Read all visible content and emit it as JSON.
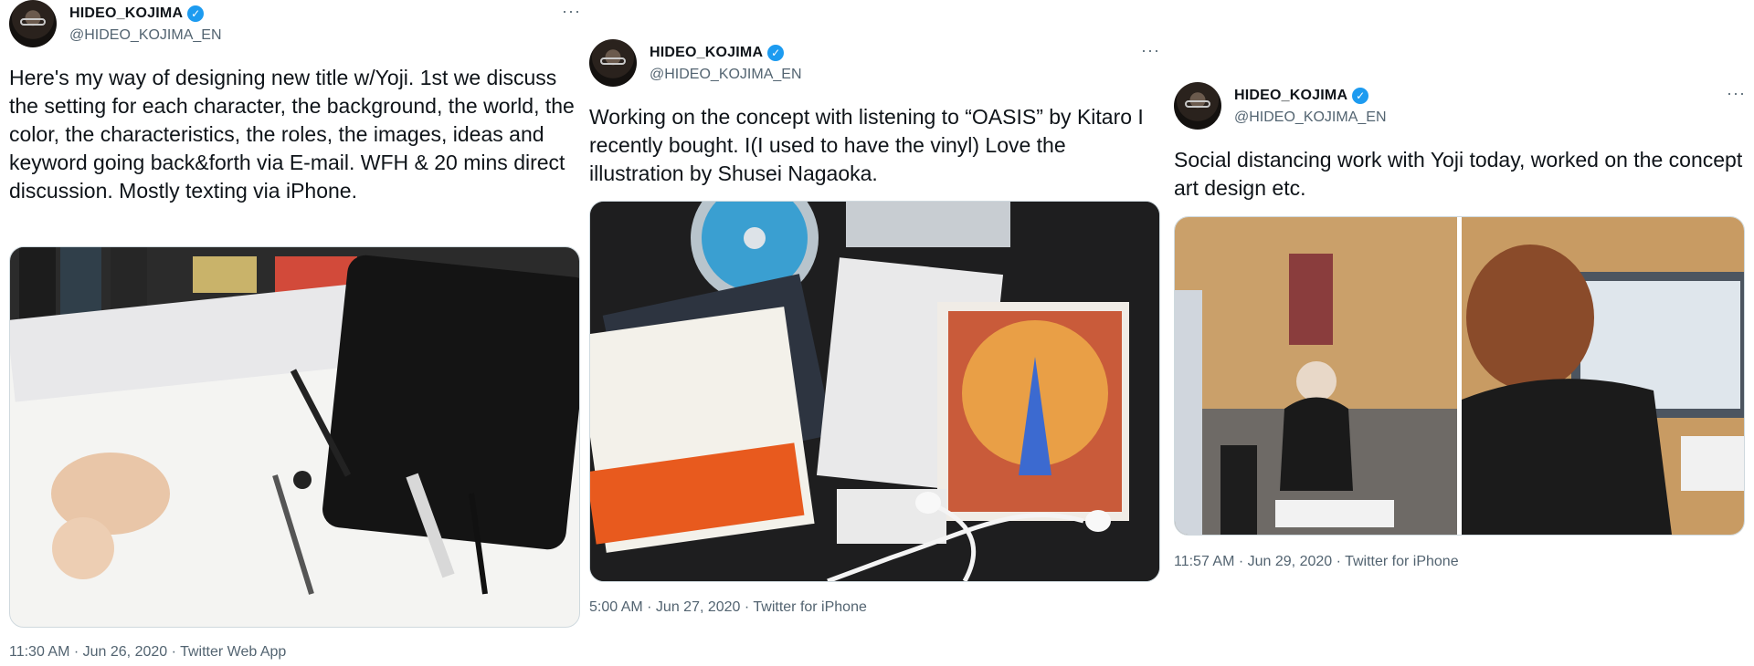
{
  "tweets": [
    {
      "name": "HIDEO_KOJIMA",
      "handle": "@HIDEO_KOJIMA_EN",
      "text": "Here's my way of designing new title w/Yoji. 1st we discuss the setting for each character, the background, the world, the color, the characteristics, the roles, the images, ideas and keyword going back&forth via E-mail. WFH & 20 mins direct discussion. Mostly texting via iPhone.",
      "timestamp": "11:30 AM · Jun 26, 2020 · Twitter Web App"
    },
    {
      "name": "HIDEO_KOJIMA",
      "handle": "@HIDEO_KOJIMA_EN",
      "text": "Working on the concept with listening to “OASIS” by Kitaro I recently bought. I(I used to have the vinyl) Love the illustration by Shusei Nagaoka.",
      "timestamp": "5:00 AM · Jun 27, 2020 · Twitter for iPhone"
    },
    {
      "name": "HIDEO_KOJIMA",
      "handle": "@HIDEO_KOJIMA_EN",
      "text": "Social distancing work with Yoji today, worked on the concept art design etc.",
      "timestamp": "11:57 AM · Jun 29, 2020 · Twitter for iPhone"
    }
  ],
  "icons": {
    "verified": "verified-badge-icon",
    "more": "more-options-icon"
  },
  "verified_glyph": "✓",
  "more_glyph": "···",
  "colors": {
    "verified": "#1d9bf0",
    "secondary_text": "#536471",
    "text": "#0f1419",
    "border": "#cfd9de"
  }
}
